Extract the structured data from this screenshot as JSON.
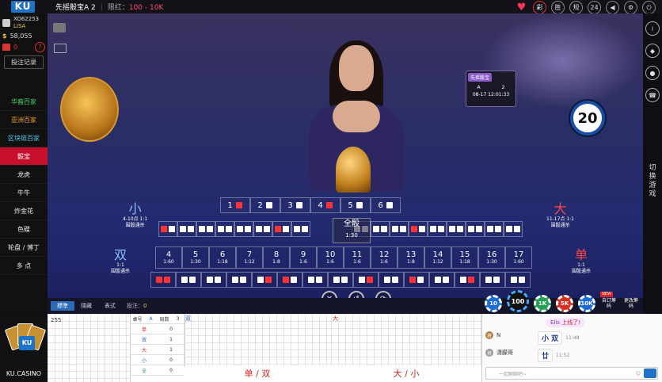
{
  "topbar": {
    "logo": "KU",
    "table_title": "先摇骰宝A",
    "table_number": "2",
    "limit_label": "限红：",
    "limit_value": "100 - 10K",
    "icons": [
      {
        "name": "heart-icon",
        "label": "♥"
      },
      {
        "name": "lottery-icon",
        "label": "彩"
      },
      {
        "name": "win-icon",
        "label": "胜"
      },
      {
        "name": "rules-icon",
        "label": "规"
      },
      {
        "name": "support-icon",
        "label": "24"
      },
      {
        "name": "volume-icon",
        "label": "◀"
      },
      {
        "name": "settings-icon",
        "label": "⚙"
      },
      {
        "name": "exit-icon",
        "label": "⏻"
      }
    ]
  },
  "user": {
    "id": "XO62253",
    "name": "LISA",
    "balance": "58,055",
    "gift_count": "0",
    "records_button": "投注记录"
  },
  "games": [
    {
      "label": "华裔百家",
      "style": "g-green"
    },
    {
      "label": "亚洲百家",
      "style": "g-orange"
    },
    {
      "label": "区块链百家",
      "style": "g-cyan"
    },
    {
      "label": "骰宝",
      "style": "g-active"
    },
    {
      "label": "龙虎",
      "style": "g-white"
    },
    {
      "label": "牛牛",
      "style": "g-white"
    },
    {
      "label": "炸金花",
      "style": "g-white"
    },
    {
      "label": "色碟",
      "style": "g-white"
    },
    {
      "label": "轮盘 / 博丁",
      "style": "g-white"
    },
    {
      "label": "多 点",
      "style": "g-white"
    }
  ],
  "stage": {
    "info_card": {
      "title": "先摇骰宝",
      "left": "A",
      "right": "2",
      "time": "08-17 12:01:33"
    },
    "countdown": "20",
    "switch_label": "切换游戏"
  },
  "board": {
    "small": {
      "char": "小",
      "range": "4-10点 1:1",
      "note": "围骰通杀"
    },
    "big": {
      "char": "大",
      "range": "11-17点 1:1",
      "note": "围骰通杀"
    },
    "even": {
      "char": "双",
      "payout": "1:1",
      "note": "围骰通杀"
    },
    "odd": {
      "char": "单",
      "payout": "1:1",
      "note": "围骰通杀"
    },
    "singles": [
      "1",
      "2",
      "3",
      "4",
      "5",
      "6"
    ],
    "any_triple": {
      "label": "全骰",
      "payout": "1:30"
    },
    "totals": [
      "4",
      "5",
      "6",
      "7",
      "8",
      "9",
      "10",
      "11",
      "12",
      "13",
      "14",
      "15",
      "16",
      "17"
    ],
    "total_payouts": [
      "1:60",
      "1:30",
      "1:18",
      "1:12",
      "1:8",
      "1:6",
      "1:6",
      "1:6",
      "1:6",
      "1:8",
      "1:12",
      "1:18",
      "1:30",
      "1:60"
    ]
  },
  "betbar": {
    "tabs": [
      "標準",
      "隱藏",
      "表式"
    ],
    "bet_label": "投注：",
    "bet_value": "0"
  },
  "chips": [
    "10",
    "100",
    "1K",
    "5K",
    "10K"
  ],
  "chip_colors": [
    "#1e6ad8",
    "#111111",
    "#22a055",
    "#d83020",
    "#1e6ad8"
  ],
  "chip_buttons": {
    "custom": "自订筹码",
    "new_tag": "NEW",
    "change": "更改筹码"
  },
  "bottom": {
    "logo_text": "KU.CASINO",
    "road_count": "255",
    "stats_header": [
      "桌号",
      "A",
      "局数",
      "3"
    ],
    "stats_rows": [
      {
        "label": "单",
        "value": "0",
        "cls": "red-t"
      },
      {
        "label": "双",
        "value": "1",
        "cls": "blue-t"
      },
      {
        "label": "大",
        "value": "1",
        "cls": "red-t"
      },
      {
        "label": "小",
        "value": "0",
        "cls": "blue-t"
      },
      {
        "label": "全",
        "value": "0",
        "cls": "green-t"
      }
    ],
    "road2_tag": "双",
    "road2_title": "单 / 双",
    "road3_tag": "大",
    "road3_title": "大 / 小"
  },
  "chat": {
    "system_user": "Elis",
    "system_msg": "上线了!",
    "msg1_user": "N",
    "msg1_text": "小 双",
    "msg1_time": "11:48",
    "msg2_user": "潇朦哥",
    "msg2_text": "廿",
    "msg2_time": "11:52",
    "placeholder": "一起聊聊吧~"
  }
}
